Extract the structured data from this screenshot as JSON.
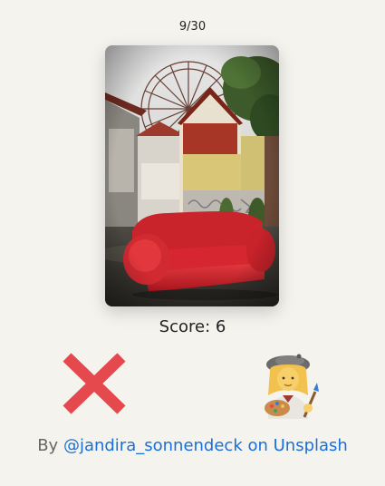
{
  "progress": {
    "current": 9,
    "total": 30,
    "label": "9/30"
  },
  "photo": {
    "alt": "Red sofa in front of a ferris wheel and abandoned buildings"
  },
  "score": {
    "label": "Score: 6"
  },
  "actions": {
    "reject_icon": "cross-mark-icon",
    "accept_icon": "artist-emoji-icon"
  },
  "credit": {
    "prefix": "By",
    "link_text": "@jandira_sonnendeck on Unsplash"
  },
  "colors": {
    "background": "#f5f3ee",
    "cross": "#e5484d",
    "link": "#1a6fd6",
    "credit_text": "#666666"
  }
}
